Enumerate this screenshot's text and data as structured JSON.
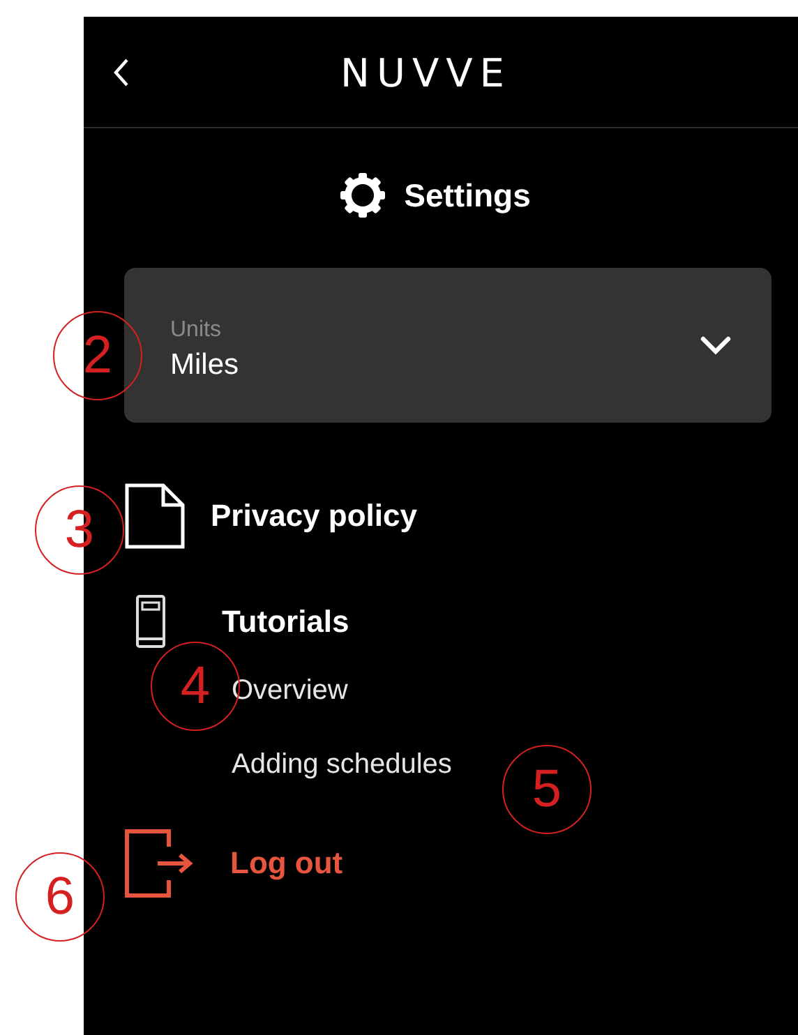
{
  "header": {
    "logo": "NUVVE"
  },
  "title": "Settings",
  "units_dropdown": {
    "label": "Units",
    "value": "Miles"
  },
  "menu": [
    {
      "kind": "document",
      "label": "Privacy policy"
    },
    {
      "kind": "book",
      "label": "Tutorials",
      "children": [
        {
          "label": "Overview"
        },
        {
          "label": "Adding schedules"
        }
      ]
    },
    {
      "kind": "logout",
      "label": "Log out"
    }
  ],
  "callouts": [
    {
      "label": "2"
    },
    {
      "label": "3"
    },
    {
      "label": "4"
    },
    {
      "label": "5"
    },
    {
      "label": "6"
    }
  ]
}
